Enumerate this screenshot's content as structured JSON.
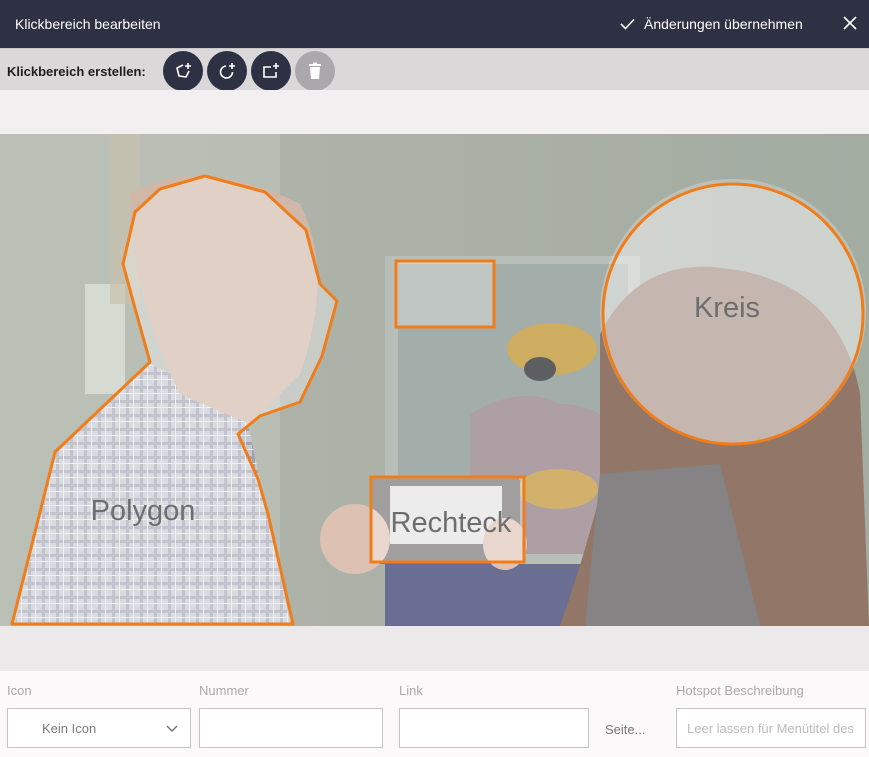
{
  "header": {
    "title": "Klickbereich bearbeiten",
    "apply_label": "Änderungen übernehmen"
  },
  "toolbar": {
    "label": "Klickbereich erstellen:",
    "buttons": [
      "add-polygon-icon",
      "add-circle-icon",
      "add-rectangle-icon",
      "trash-icon"
    ]
  },
  "hotspots": {
    "polygon_label": "Polygon",
    "rectangle_label": "Rechteck",
    "circle_label": "Kreis"
  },
  "form": {
    "icon_label": "Icon",
    "icon_value": "Kein Icon",
    "number_label": "Nummer",
    "number_value": "",
    "link_label": "Link",
    "link_value": "",
    "page_link_label": "Seite...",
    "description_label": "Hotspot Beschreibung",
    "description_placeholder": "Leer lassen für Menütitel des"
  },
  "colors": {
    "header_bg": "#2d3143",
    "accent_outline": "#f07d1a",
    "disabled_button": "#aaa8ab"
  }
}
